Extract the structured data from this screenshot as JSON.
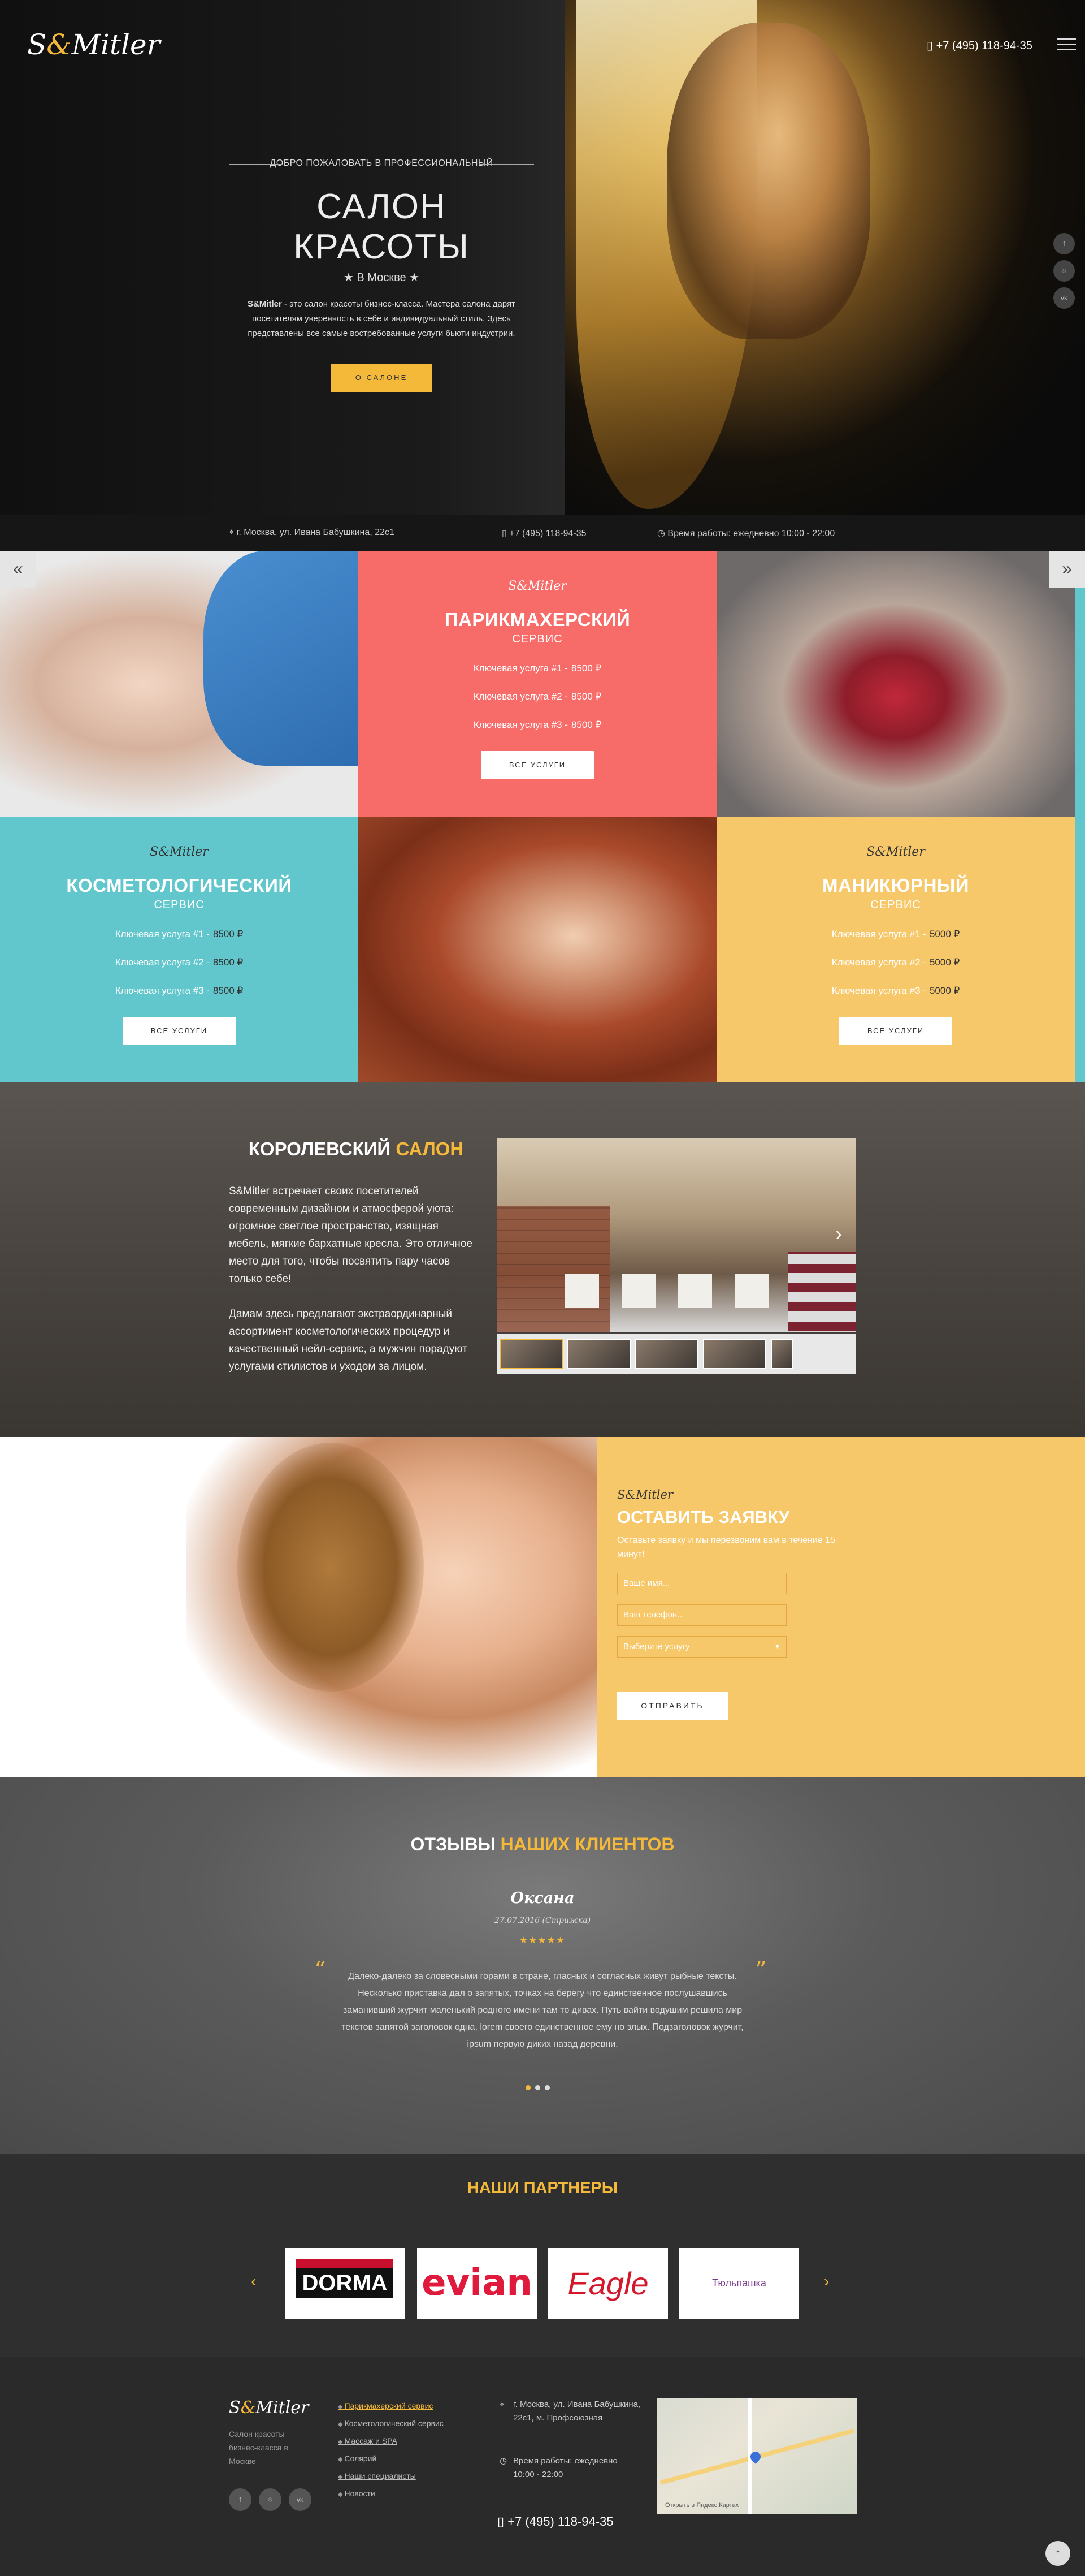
{
  "header": {
    "logo_main": "Mitler",
    "logo_s": "S",
    "logo_amp": "&",
    "phone": "+7 (495) 118-94-35",
    "welcome": "ДОБРО ПОЖАЛОВАТЬ В ПРОФЕССИОНАЛЬНЫЙ",
    "title": "САЛОН КРАСОТЫ",
    "city": "★   В Москве   ★",
    "desc_brand": "S&Mitler",
    "desc": " - это салон красоты бизнес-класса. Мастера салона дарят посетителям уверенность в себе и индивидуальный стиль. Здесь представлены все самые востребованные услуги бьюти индустрии.",
    "button": "О САЛОНЕ",
    "social": [
      "f",
      "⌾",
      "vk"
    ]
  },
  "infobar": {
    "address": "⌖  г. Москва, ул. Ивана Бабушкина, 22с1",
    "phone": "▯  +7 (495) 118-94-35",
    "hours": "◷  Время работы: ежедневно 10:00 - 22:00"
  },
  "nav_arrows": {
    "left": "«",
    "right": "»"
  },
  "services": [
    {
      "brand": "S&Mitler",
      "title": "ПАРИКМАХЕРСКИЙ",
      "subtitle": "СЕРВИС",
      "rows": [
        {
          "label": "Ключевая услуга #1 -",
          "price": "8500 ₽"
        },
        {
          "label": "Ключевая услуга #2 -",
          "price": "8500 ₽"
        },
        {
          "label": "Ключевая услуга #3 -",
          "price": "8500 ₽"
        }
      ],
      "button": "ВСЕ УСЛУГИ"
    },
    {
      "brand": "S&Mitler",
      "title": "КОСМЕТОЛОГИЧЕСКИЙ",
      "subtitle": "СЕРВИС",
      "rows": [
        {
          "label": "Ключевая услуга #1 -",
          "price": "8500 ₽"
        },
        {
          "label": "Ключевая услуга #2 -",
          "price": "8500 ₽"
        },
        {
          "label": "Ключевая услуга #3 -",
          "price": "8500 ₽"
        }
      ],
      "button": "ВСЕ УСЛУГИ"
    },
    {
      "brand": "S&Mitler",
      "title": "МАНИКЮРНЫЙ",
      "subtitle": "СЕРВИС",
      "rows": [
        {
          "label": "Ключевая услуга #1 -",
          "price": "5000 ₽"
        },
        {
          "label": "Ключевая услуга #2 -",
          "price": "5000 ₽"
        },
        {
          "label": "Ключевая услуга #3 -",
          "price": "5000 ₽"
        }
      ],
      "button": "ВСЕ УСЛУГИ"
    }
  ],
  "royal": {
    "title_a": "КОРОЛЕВСКИЙ",
    "title_b": "САЛОН",
    "p1": "S&Mitler встречает своих посетителей современным дизайном и атмосферой уюта: огромное светлое пространство, изящная мебель, мягкие бархатные кресла. Это отличное место для того, чтобы посвятить пару часов только себе!",
    "p2": "Дамам здесь предлагают экстраординарный ассортимент косметологических процедур и качественный нейл-сервис, а мужчин порадуют услугами стилистов и уходом за лицом.",
    "next": "›"
  },
  "request": {
    "brand": "S&Mitler",
    "title": "ОСТАВИТЬ ЗАЯВКУ",
    "subtitle": "Оставьте заявку и мы перезвоним вам в течение 15 минут!",
    "name_placeholder": "Ваше имя...",
    "phone_placeholder": "Ваш телефон...",
    "select_value": "Выберите услугу",
    "button": "ОТПРАВИТЬ"
  },
  "reviews": {
    "title_a": "ОТЗЫВЫ",
    "title_b": "НАШИХ КЛИЕНТОВ",
    "name": "Оксана",
    "date": "27.07.2016 (Стрижка)",
    "stars": "★★★★★",
    "text": "Далеко-далеко за словесными горами в стране, гласных и согласных живут рыбные тексты. Несколько приставка дал о запятых, точках на берегу что единственное послушавшись заманивший журчит маленький родного имени там то дивах. Путь вайти водушим решила мир текстов запятой заголовок одна, lorem своего единственное ему но злых. Подзаголовок журчит, ipsum первую диких назад деревни.",
    "quote_open": "“",
    "quote_close": "”"
  },
  "partners": {
    "title": "НАШИ ПАРТНЕРЫ",
    "logos": [
      "DORMA",
      "evian",
      "Eagle",
      "Тюльпашка"
    ],
    "prev": "‹",
    "next": "›"
  },
  "footer": {
    "brand_s": "S",
    "brand_amp": "&",
    "brand_main": "Mitler",
    "desc": "Салон красоты бизнес-класса в Москве",
    "links": [
      "Парикмахерский сервис",
      "Косметологический сервис",
      "Массаж и SPA",
      "Солярий",
      "Наши специалисты",
      "Новости"
    ],
    "address": "г. Москва, ул. Ивана Бабушкина, 22с1, м. Профсоюзная",
    "hours": "Время работы: ежедневно 10:00 - 22:00",
    "phone": "▯  +7 (495) 118-94-35",
    "map_caption": "Открыть в Яндекс.Картах",
    "social": [
      "f",
      "⌾",
      "vk"
    ],
    "up": "⌃"
  },
  "colors": {
    "accent": "#f5b93a",
    "coral": "#f76b69",
    "teal": "#62c7cd",
    "yellow": "#f7c86a"
  }
}
